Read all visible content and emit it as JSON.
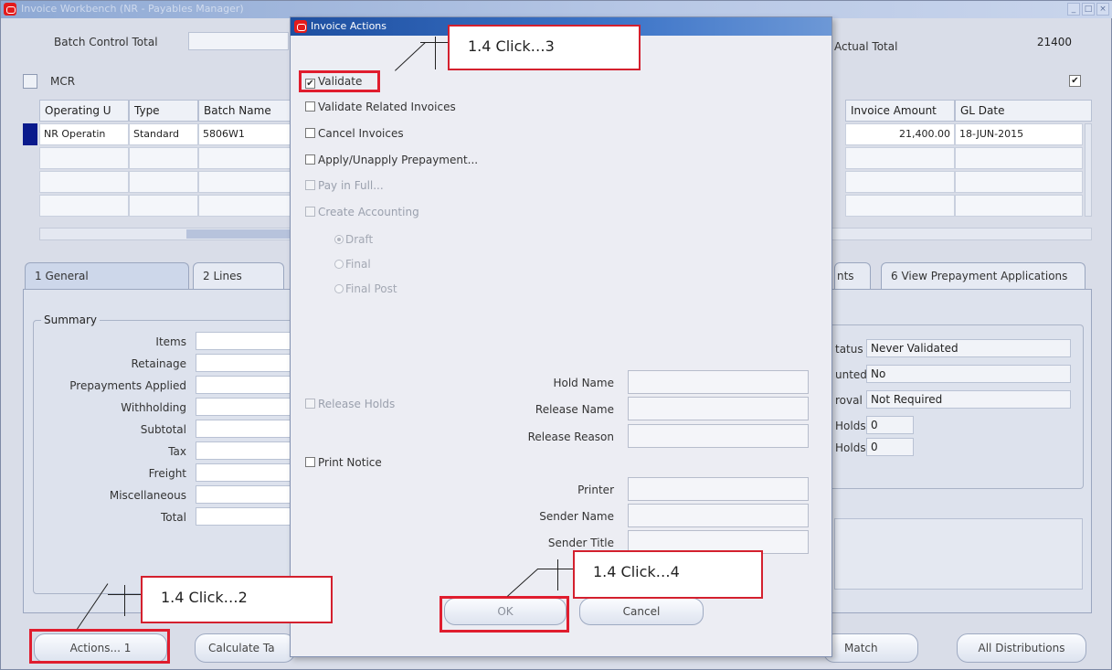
{
  "window": {
    "title": "Invoice Workbench (NR - Payables Manager)"
  },
  "header": {
    "batch_control_total_label": "Batch Control Total",
    "actual_total_label": "Actual Total",
    "actual_total_value": "21400",
    "mcr_label": "MCR",
    "right_checkbox_mark": "✔"
  },
  "invoice_grid": {
    "columns": [
      "Operating U",
      "Type",
      "Batch Name",
      "Invoice Amount",
      "GL Date"
    ],
    "rows": [
      {
        "operating_unit": "NR Operatin",
        "type": "Standard",
        "batch_name": "5806W1",
        "invoice_amount": "21,400.00",
        "gl_date": "18-JUN-2015"
      }
    ]
  },
  "tabs": [
    "1 General",
    "2 Lines",
    "nts",
    "6 View Prepayment Applications"
  ],
  "summary": {
    "legend": "Summary",
    "labels": [
      "Items",
      "Retainage",
      "Prepayments Applied",
      "Withholding",
      "Subtotal",
      "Tax",
      "Freight",
      "Miscellaneous",
      "Total"
    ]
  },
  "status_panel": {
    "status_label": "tatus",
    "status_value": "Never Validated",
    "accounted_label": "unted",
    "accounted_value": "No",
    "approval_label": "roval",
    "approval_value": "Not Required",
    "holds_label": "Holds",
    "holds_value": "0",
    "release_holds_label": "Holds",
    "release_holds_value": "0"
  },
  "bottom_buttons": {
    "actions": "Actions... 1",
    "calculate_tax": "Calculate Ta",
    "match": "Match",
    "all_distributions": "All Distributions"
  },
  "dialog": {
    "title": "Invoice Actions",
    "check_mark": "✔",
    "options": {
      "validate": "Validate",
      "validate_related": "Validate Related Invoices",
      "cancel_invoices": "Cancel Invoices",
      "apply_prepayment": "Apply/Unapply Prepayment...",
      "pay_in_full": "Pay in Full...",
      "create_accounting": "Create Accounting",
      "draft": "Draft",
      "final": "Final",
      "final_post": "Final Post",
      "release_holds": "Release Holds",
      "print_notice": "Print Notice"
    },
    "fields": {
      "hold_name": "Hold Name",
      "release_name": "Release Name",
      "release_reason": "Release Reason",
      "printer": "Printer",
      "sender_name": "Sender Name",
      "sender_title": "Sender Title"
    },
    "buttons": {
      "ok": "OK",
      "cancel": "Cancel"
    }
  },
  "callouts": {
    "step2": "1.4 Click…2",
    "step3": "1.4 Click…3",
    "step4": "1.4 Click…4"
  },
  "colors": {
    "highlight_red": "#e01d2e",
    "dialog_title_blue": "#1e4fa0",
    "record_indicator": "#0a1a8c"
  }
}
